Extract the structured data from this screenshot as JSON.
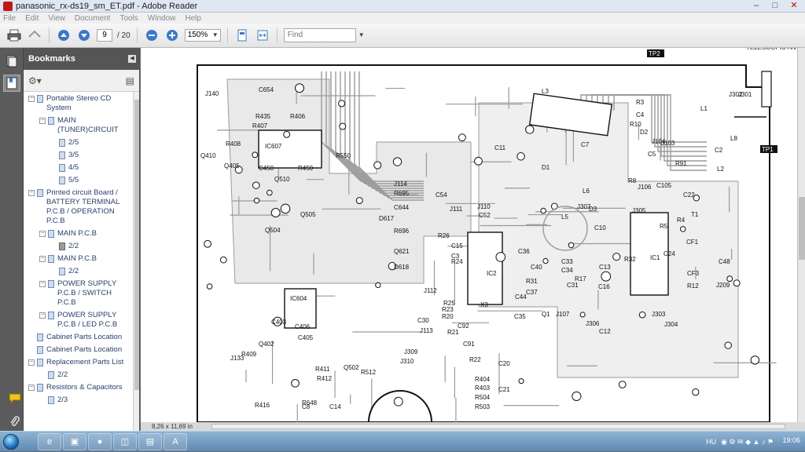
{
  "window": {
    "title": "panasonic_rx-ds19_sm_ET.pdf - Adobe Reader",
    "controls": [
      "–",
      "□",
      "✕"
    ]
  },
  "menu": [
    "File",
    "Edit",
    "View",
    "Document",
    "Tools",
    "Window",
    "Help"
  ],
  "toolbar": {
    "page_current": "9",
    "page_total": "/ 20",
    "zoom": "150%",
    "find_placeholder": "Find"
  },
  "bookmarks": {
    "title": "Bookmarks",
    "items": [
      {
        "label": "Portable Stereo CD System",
        "level": 0,
        "toggle": "−"
      },
      {
        "label": "MAIN (TUNER)CIRCUIT",
        "level": 1,
        "toggle": "−"
      },
      {
        "label": "2/5",
        "level": 2
      },
      {
        "label": "3/5",
        "level": 2
      },
      {
        "label": "4/5",
        "level": 2
      },
      {
        "label": "5/5",
        "level": 2
      },
      {
        "label": "Printed circuit Board / BATTERY TERMINAL P.C.B / OPERATION P.C.B",
        "level": 0,
        "toggle": "−"
      },
      {
        "label": "MAIN P.C.B",
        "level": 1,
        "toggle": "−"
      },
      {
        "label": "2/2",
        "level": 2,
        "active": true
      },
      {
        "label": "MAIN P.C.B",
        "level": 1,
        "toggle": "−"
      },
      {
        "label": "2/2",
        "level": 2
      },
      {
        "label": "POWER SUPPLY P.C.B / SWITCH P.C.B",
        "level": 1,
        "toggle": "−"
      },
      {
        "label": "POWER SUPPLY P.C.B / LED P.C.B",
        "level": 1,
        "toggle": "−"
      },
      {
        "label": "Cabinet Parts Location",
        "level": 0
      },
      {
        "label": "Cabinet Parts Location",
        "level": 0
      },
      {
        "label": "Replacement Parts List",
        "level": 0,
        "toggle": "−"
      },
      {
        "label": "2/2",
        "level": 1
      },
      {
        "label": "Resistors & Capacitors",
        "level": 0,
        "toggle": "−"
      },
      {
        "label": "2/3",
        "level": 1
      }
    ]
  },
  "status": {
    "page_size": "8,26 x 11,69 in"
  },
  "pcb": {
    "labels": [
      "TP2",
      "TP1",
      "TELESCOPIC ANTENNA",
      "J140",
      "C654",
      "R435",
      "R406",
      "IC607",
      "R408",
      "R407",
      "Q410",
      "Q405",
      "C450",
      "R450",
      "Q510",
      "R550",
      "L3",
      "R3",
      "C4",
      "R10",
      "D2",
      "J103",
      "L1",
      "J301",
      "J302",
      "L8",
      "C2",
      "L2",
      "C11",
      "D1",
      "L6",
      "C7",
      "R91",
      "J104",
      "C5",
      "R8",
      "J106",
      "C105",
      "J114",
      "R695",
      "C644",
      "D617",
      "R696",
      "Q621",
      "C54",
      "J110",
      "C52",
      "L5",
      "J307",
      "D3",
      "J305",
      "C22",
      "T1",
      "R4",
      "R5",
      "IC2",
      "IC1",
      "CF1",
      "C10",
      "R32",
      "C13",
      "C24",
      "C48",
      "CF3",
      "R12",
      "J209",
      "C33",
      "C34",
      "R17",
      "C31",
      "C16",
      "R31",
      "C36",
      "C40",
      "C37",
      "C44",
      "D618",
      "J112",
      "Q505",
      "Q504",
      "IC604",
      "C403",
      "C406",
      "C405",
      "Q402",
      "R411",
      "R412",
      "R512",
      "Q502",
      "R409",
      "J133",
      "R416",
      "R648",
      "J309",
      "J310",
      "C30",
      "J113",
      "R25",
      "R23",
      "R20",
      "R21",
      "C92",
      "C91",
      "R22",
      "C20",
      "C21",
      "R404",
      "R403",
      "R504",
      "R503",
      "X3",
      "Q1",
      "C35",
      "J107",
      "J306",
      "J303",
      "J304",
      "C12",
      "C15",
      "C3",
      "R24",
      "R26",
      "J111",
      "C8",
      "C14"
    ]
  },
  "taskbar": {
    "apps": [
      "e",
      "▣",
      "●",
      "◫",
      "▤",
      "A"
    ],
    "language": "HU",
    "clock": "19:06"
  },
  "colors": {
    "bookmark_text": "#2a3f6b",
    "pcb_trace": "#9a9a9a",
    "pcb_ink": "#111111",
    "taskbar": "#6b93b9"
  }
}
